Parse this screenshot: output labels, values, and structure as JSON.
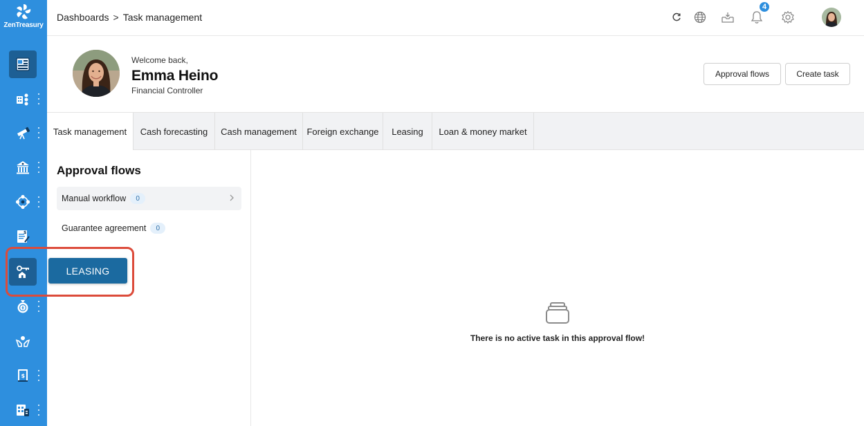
{
  "app": {
    "brand": "ZenTreasury"
  },
  "breadcrumb": {
    "root": "Dashboards",
    "separator": ">",
    "current": "Task management"
  },
  "top_icons": [
    {
      "name": "refresh-icon"
    },
    {
      "name": "globe-icon"
    },
    {
      "name": "inbox-download-icon"
    },
    {
      "name": "bell-icon",
      "badge": "4"
    },
    {
      "name": "gear-icon"
    },
    {
      "name": "user-avatar"
    }
  ],
  "user": {
    "welcome": "Welcome back,",
    "name": "Emma Heino",
    "role": "Financial Controller"
  },
  "header_actions": {
    "approval_flows_label": "Approval flows",
    "create_task_label": "Create task"
  },
  "tabs": [
    {
      "label": "Task management",
      "active": true
    },
    {
      "label": "Cash forecasting"
    },
    {
      "label": "Cash management"
    },
    {
      "label": "Foreign exchange"
    },
    {
      "label": "Leasing"
    },
    {
      "label": "Loan & money market"
    }
  ],
  "approval_panel": {
    "title": "Approval flows",
    "items": [
      {
        "label": "Manual workflow",
        "count": "0",
        "selected": true
      },
      {
        "label": "Guarantee agreement",
        "count": "0"
      }
    ]
  },
  "empty_state": {
    "message": "There is no active task in this approval flow!"
  },
  "sidebar": {
    "items": [
      {
        "name": "dashboard-icon",
        "active": true
      },
      {
        "name": "entities-icon"
      },
      {
        "name": "telescope-icon"
      },
      {
        "name": "bank-icon"
      },
      {
        "name": "network-icon"
      },
      {
        "name": "invoice-icon"
      },
      {
        "name": "leasing-icon",
        "active": true
      },
      {
        "name": "money-bag-icon"
      },
      {
        "name": "hands-icon"
      },
      {
        "name": "ledger-icon"
      },
      {
        "name": "report-icon"
      }
    ],
    "tooltip": "LEASING"
  },
  "colors": {
    "sidebar": "#2e8fde",
    "sidebar_active": "#1d5f94",
    "tooltip": "#1b6aa0",
    "callout": "#dc4b3a"
  }
}
